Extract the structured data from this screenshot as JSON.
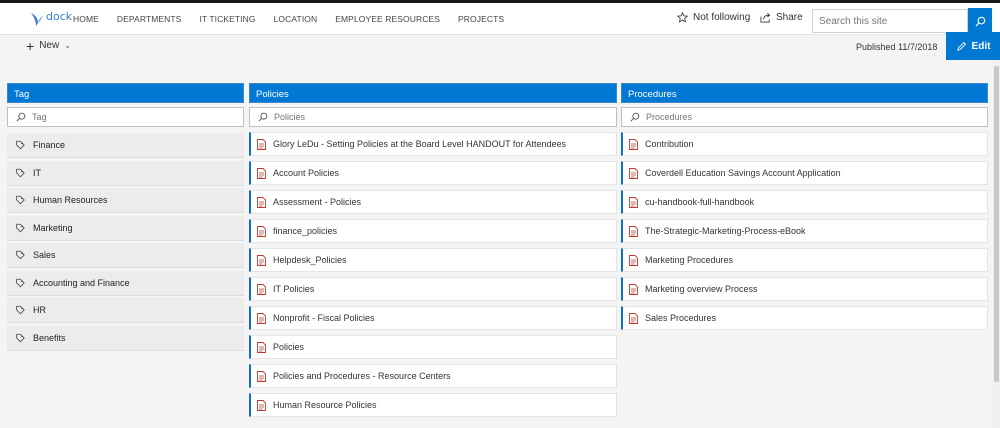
{
  "header": {
    "logo_text": "dock",
    "nav": [
      "HOME",
      "DEPARTMENTS",
      "IT TICKETING",
      "LOCATION",
      "EMPLOYEE RESOURCES",
      "PROJECTS"
    ],
    "follow_label": "Not following",
    "share_label": "Share",
    "search_placeholder": "Search this site"
  },
  "commandbar": {
    "new_label": "New",
    "published": "Published 11/7/2018",
    "edit_label": "Edit"
  },
  "columns": {
    "tag": {
      "title": "Tag",
      "filter_placeholder": "Tag",
      "items": [
        "Finance",
        "IT",
        "Human Resources",
        "Marketing",
        "Sales",
        "Accounting and Finance",
        "HR",
        "Benefits"
      ]
    },
    "policies": {
      "title": "Policies",
      "filter_placeholder": "Policies",
      "items": [
        "Glory LeDu - Setting Policies at the Board Level HANDOUT for Attendees",
        "Account Policies",
        "Assessment - Policies",
        "finance_policies",
        "Helpdesk_Policies",
        "IT Policies",
        "Nonprofit - Fiscal Policies",
        "Policies",
        "Policies and Procedures - Resource Centers",
        "Human Resource Policies"
      ]
    },
    "procedures": {
      "title": "Procedures",
      "filter_placeholder": "Procedures",
      "items": [
        "Contribution",
        "Coverdell Education Savings Account Application",
        "cu-handbook-full-handbook",
        "The-Strategic-Marketing-Process-eBook",
        "Marketing Procedures",
        "Marketing overview Process",
        "Sales Procedures"
      ]
    }
  },
  "colors": {
    "accent": "#0078d4",
    "doc_icon": "#c0392b"
  }
}
